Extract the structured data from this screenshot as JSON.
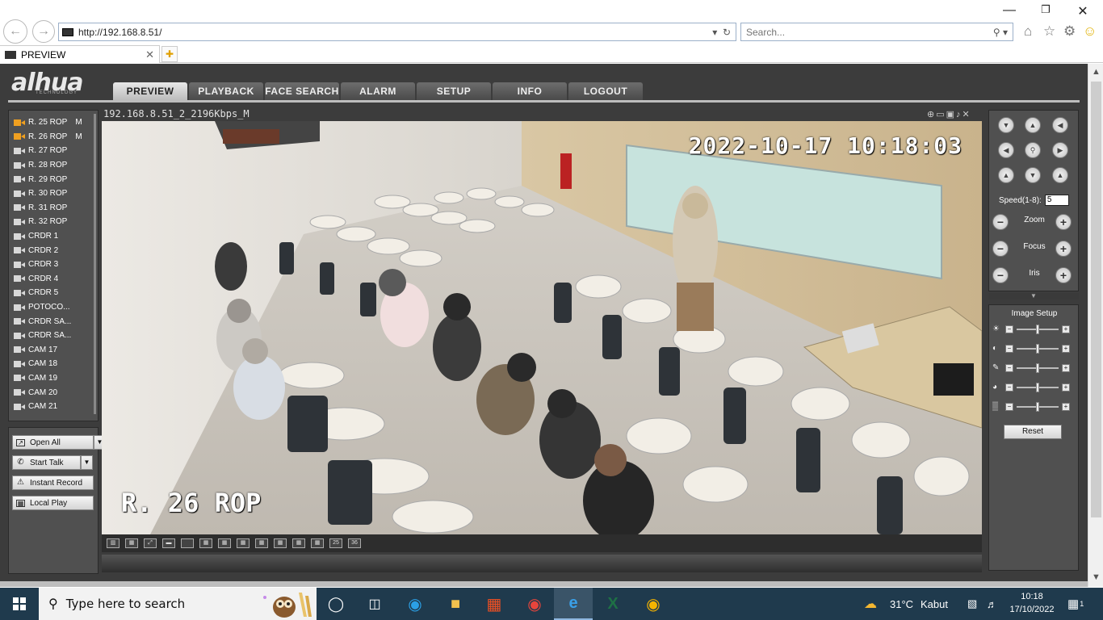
{
  "browser": {
    "url": "http://192.168.8.51/",
    "search_placeholder": "Search...",
    "tab_title": "PREVIEW"
  },
  "app": {
    "brand": "alhua",
    "brand_sub": "TECHNOLOGY",
    "nav": [
      "PREVIEW",
      "PLAYBACK",
      "FACE SEARCH",
      "ALARM",
      "SETUP",
      "INFO",
      "LOGOUT"
    ],
    "active_nav": "PREVIEW"
  },
  "cameras": [
    {
      "name": "R. 25 ROP",
      "flag": "M",
      "live": true
    },
    {
      "name": "R. 26 ROP",
      "flag": "M",
      "live": true
    },
    {
      "name": "R. 27 ROP",
      "flag": "",
      "live": false
    },
    {
      "name": "R. 28 ROP",
      "flag": "",
      "live": false
    },
    {
      "name": "R. 29 ROP",
      "flag": "",
      "live": false
    },
    {
      "name": "R. 30 ROP",
      "flag": "",
      "live": false
    },
    {
      "name": "R. 31 ROP",
      "flag": "",
      "live": false
    },
    {
      "name": "R. 32 ROP",
      "flag": "",
      "live": false
    },
    {
      "name": "CRDR 1",
      "flag": "",
      "live": false
    },
    {
      "name": "CRDR 2",
      "flag": "",
      "live": false
    },
    {
      "name": "CRDR 3",
      "flag": "",
      "live": false
    },
    {
      "name": "CRDR 4",
      "flag": "",
      "live": false
    },
    {
      "name": "CRDR 5",
      "flag": "",
      "live": false
    },
    {
      "name": "POTOCO...",
      "flag": "",
      "live": false
    },
    {
      "name": "CRDR SA...",
      "flag": "",
      "live": false
    },
    {
      "name": "CRDR SA...",
      "flag": "",
      "live": false
    },
    {
      "name": "CAM 17",
      "flag": "",
      "live": false
    },
    {
      "name": "CAM 18",
      "flag": "",
      "live": false
    },
    {
      "name": "CAM 19",
      "flag": "",
      "live": false
    },
    {
      "name": "CAM 20",
      "flag": "",
      "live": false
    },
    {
      "name": "CAM 21",
      "flag": "",
      "live": false
    }
  ],
  "controls": {
    "open_all": "Open All",
    "start_talk": "Start Talk",
    "instant_record": "Instant Record",
    "local_play": "Local Play"
  },
  "video": {
    "stream_title": "192.168.8.51_2_2196Kbps_M",
    "osd_time": "2022-10-17 10:18:03",
    "osd_name": "R. 26 ROP",
    "layout_labels": [
      "25",
      "36"
    ]
  },
  "ptz": {
    "speed_label": "Speed(1-8):",
    "speed_value": "5",
    "zoom": "Zoom",
    "focus": "Focus",
    "iris": "Iris"
  },
  "image_setup": {
    "title": "Image Setup",
    "reset": "Reset",
    "sliders": [
      {
        "icon": "brightness-icon",
        "value": 0.5
      },
      {
        "icon": "contrast-icon",
        "value": 0.5
      },
      {
        "icon": "saturation-icon",
        "value": 0.5
      },
      {
        "icon": "hue-icon",
        "value": 0.5
      },
      {
        "icon": "sharpness-icon",
        "value": 0.5
      }
    ]
  },
  "taskbar": {
    "search_placeholder": "Type here to search",
    "weather_temp": "31°C",
    "weather_desc": "Kabut",
    "time": "10:18",
    "date": "17/10/2022",
    "notification_count": "1"
  }
}
